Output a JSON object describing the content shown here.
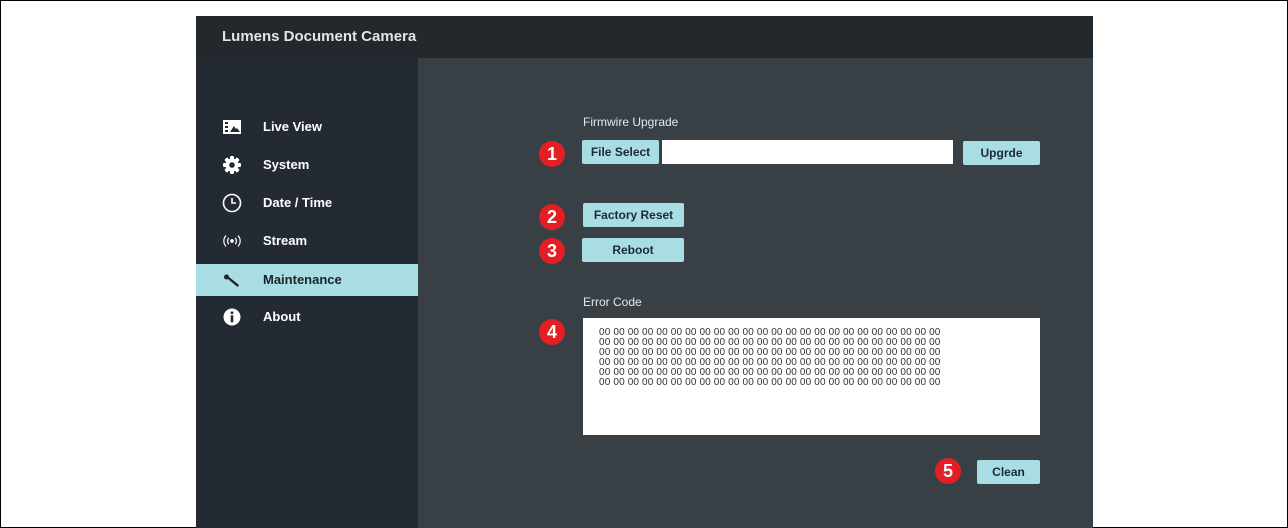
{
  "app": {
    "title": "Lumens Document Camera"
  },
  "sidebar": {
    "items": [
      {
        "label": "Live View",
        "icon": "image-icon",
        "active": false
      },
      {
        "label": "System",
        "icon": "gear-icon",
        "active": false
      },
      {
        "label": "Date / Time",
        "icon": "clock-icon",
        "active": false
      },
      {
        "label": "Stream",
        "icon": "broadcast-icon",
        "active": false
      },
      {
        "label": "Maintenance",
        "icon": "wrench-icon",
        "active": true
      },
      {
        "label": "About",
        "icon": "info-icon",
        "active": false
      }
    ]
  },
  "firmware": {
    "label": "Firmwire Upgrade",
    "file_select_label": "File Select",
    "file_value": "",
    "upgrade_label": "Upgrde"
  },
  "actions": {
    "factory_reset_label": "Factory  Reset",
    "reboot_label": "Reboot"
  },
  "error_code": {
    "label": "Error Code",
    "lines": [
      "00 00 00 00 00 00 00 00 00 00 00 00 00 00 00 00 00 00 00 00 00 00 00 00",
      "00 00 00 00 00 00 00 00 00 00 00 00 00 00 00 00 00 00 00 00 00 00 00 00",
      "00 00 00 00 00 00 00 00 00 00 00 00 00 00 00 00 00 00 00 00 00 00 00 00",
      "00 00 00 00 00 00 00 00 00 00 00 00 00 00 00 00 00 00 00 00 00 00 00 00",
      "00 00 00 00 00 00 00 00 00 00 00 00 00 00 00 00 00 00 00 00 00 00 00 00",
      "00 00 00 00 00 00 00 00 00 00 00 00 00 00 00 00 00 00 00 00 00 00 00 00"
    ],
    "clean_label": "Clean"
  },
  "markers": [
    "1",
    "2",
    "3",
    "4",
    "5"
  ],
  "colors": {
    "accent": "#a9dde4",
    "sidebar_bg": "#232a31",
    "main_bg": "#384045",
    "titlebar_bg": "#22282c",
    "marker": "#e31e24"
  }
}
